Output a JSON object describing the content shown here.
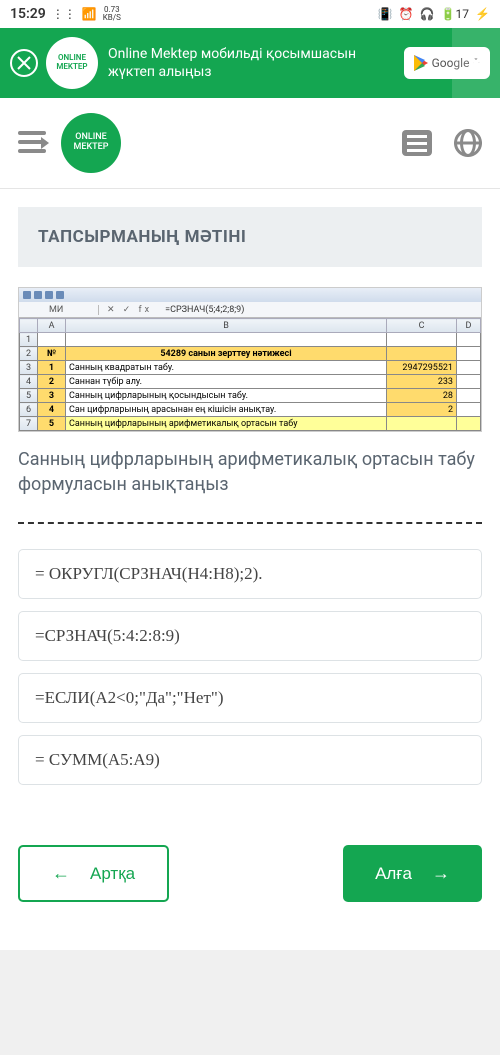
{
  "status": {
    "time": "15:29",
    "speed_val": "0.73",
    "speed_unit": "KB/S",
    "battery": "17"
  },
  "banner": {
    "logo": "ONLINE MEKTEP",
    "text": "Online Mektep мобильді қосымшасын жүктеп алыңыз",
    "store": "Google P"
  },
  "header": {
    "logo": "ONLINE MEKTEP"
  },
  "task": {
    "title": "ТАПСЫРМАНЫҢ МӘТІНІ",
    "question": "Санның цифрларының арифметикалық ортасын табу формуласын анықтаңыз"
  },
  "excel": {
    "name_box": "МИ",
    "formula": "=СРЗНАЧ(5;4;2;8;9)",
    "cols": [
      "",
      "A",
      "B",
      "C",
      "D"
    ],
    "rows": [
      {
        "n": "1",
        "a": "",
        "b": "",
        "c": "",
        "d": ""
      },
      {
        "n": "2",
        "a": "№",
        "b": "54289 санын зерттеу нәтижесі",
        "c": "",
        "d": ""
      },
      {
        "n": "3",
        "a": "1",
        "b": "Санның квадратын табу.",
        "c": "2947295521",
        "d": ""
      },
      {
        "n": "4",
        "a": "2",
        "b": "Саннан түбір алу.",
        "c": "233",
        "d": ""
      },
      {
        "n": "5",
        "a": "3",
        "b": "Санның цифрларының қосындысын табу.",
        "c": "28",
        "d": ""
      },
      {
        "n": "6",
        "a": "4",
        "b": "Сан цифрларының арасынан ең кішісін анықтау.",
        "c": "2",
        "d": ""
      },
      {
        "n": "7",
        "a": "5",
        "b": "Санның цифрларының арифметикалық ортасын табу",
        "c": "",
        "d": ""
      }
    ]
  },
  "answers": [
    "= ОКРУГЛ(СРЗНАЧ(H4:H8);2).",
    "=СРЗНАЧ(5:4:2:8:9)",
    "=ЕСЛИ(A2<0;\"Да\";\"Нет\")",
    "= СУММ(A5:A9)"
  ],
  "nav": {
    "back": "Артқа",
    "next": "Алға"
  }
}
